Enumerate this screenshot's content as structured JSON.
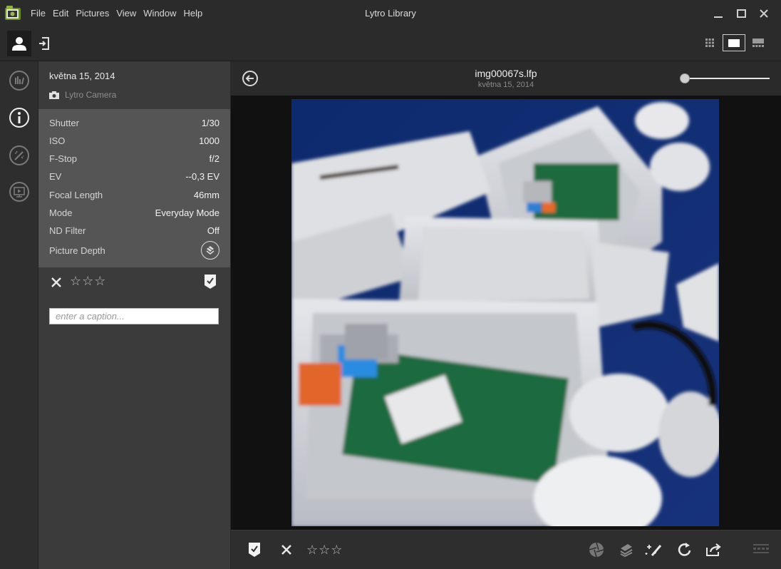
{
  "window": {
    "title": "Lytro Library",
    "menu": [
      "File",
      "Edit",
      "Pictures",
      "View",
      "Window",
      "Help"
    ]
  },
  "panel": {
    "date": "května 15, 2014",
    "camera": "Lytro Camera",
    "exif": [
      {
        "key": "Shutter",
        "value": "1/30"
      },
      {
        "key": "ISO",
        "value": "1000"
      },
      {
        "key": "F-Stop",
        "value": "f/2"
      },
      {
        "key": "EV",
        "value": "--0,3 EV"
      },
      {
        "key": "Focal Length",
        "value": "46mm"
      },
      {
        "key": "Mode",
        "value": "Everyday Mode"
      },
      {
        "key": "ND Filter",
        "value": "Off"
      },
      {
        "key": "Picture Depth",
        "value": ""
      }
    ],
    "rating": "☆☆☆",
    "caption_placeholder": "enter a caption..."
  },
  "viewer": {
    "file_name": "img00067s.lfp",
    "file_date": "května 15, 2014",
    "zoom_fraction": 0.0
  },
  "bottombar": {
    "rating": "☆☆☆"
  },
  "icons": {
    "app": "lytro-folder-icon",
    "person": "person-icon",
    "import": "import-icon",
    "grid_view": "grid-view-icon",
    "single_view": "single-view-icon",
    "filmstrip_view": "filmstrip-view-icon",
    "rail": [
      "histogram-icon",
      "info-icon",
      "adjust-icon",
      "slideshow-icon"
    ],
    "back": "back-arrow-icon",
    "picture_depth": "depth-icon",
    "reject": "close-icon",
    "pick": "pick-flag-icon",
    "bottom_right": [
      "aperture-icon",
      "layers-icon",
      "magic-wand-icon",
      "rotate-icon",
      "share-icon",
      "panel-toggle-icon"
    ]
  },
  "colors": {
    "app_background": "#2a2a2a",
    "panel": "#3b3b3b",
    "exif_background": "#555555",
    "viewer_background": "#111111"
  }
}
